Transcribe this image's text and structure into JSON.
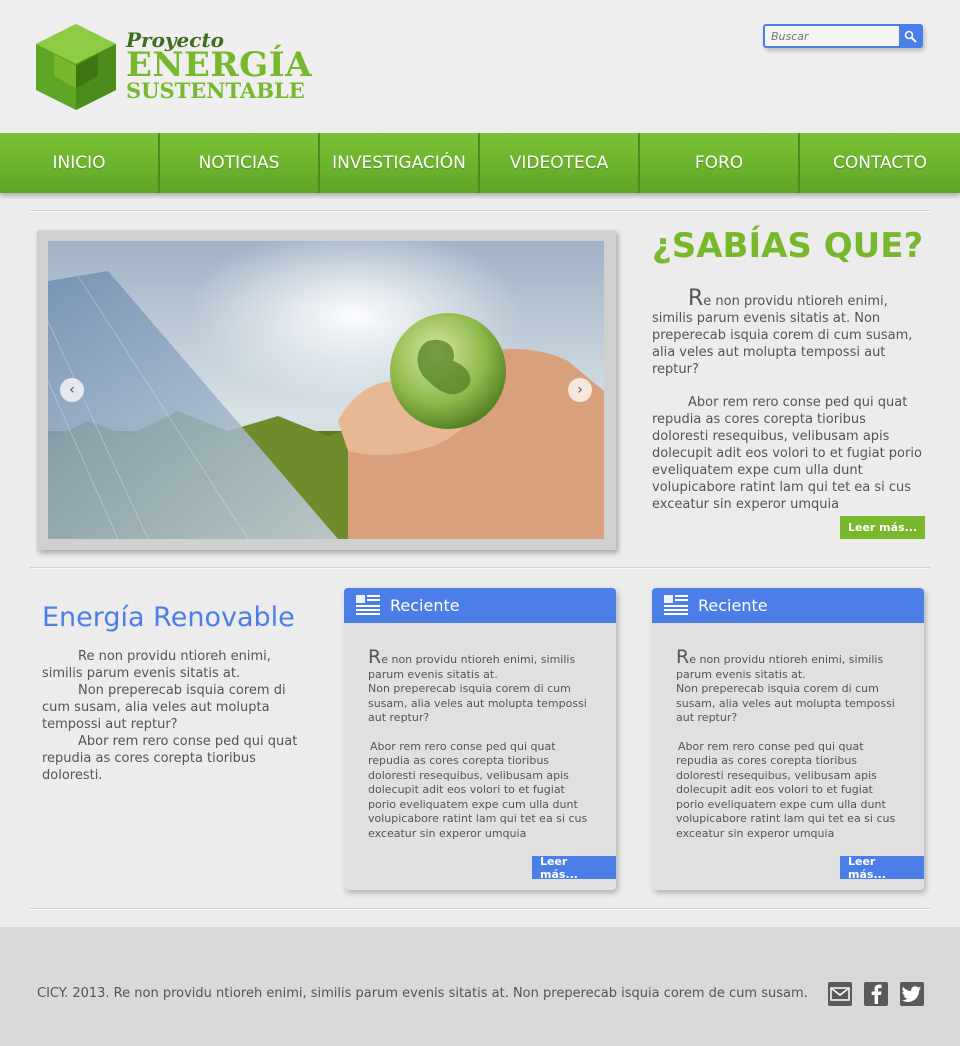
{
  "header": {
    "logo_line1": "Proyecto",
    "logo_line2": "ENERGÍA",
    "logo_line3": "SUSTENTABLE",
    "search_placeholder": "Buscar"
  },
  "nav": {
    "items": [
      {
        "label": "INICIO"
      },
      {
        "label": "NOTICIAS"
      },
      {
        "label": "INVESTIGACIÓN"
      },
      {
        "label": "VIDEOTECA"
      },
      {
        "label": "FORO"
      },
      {
        "label": "CONTACTO"
      }
    ]
  },
  "slider": {
    "image": "hands-holding-globe-solar-panel",
    "prev_label": "‹",
    "next_label": "›"
  },
  "sabias": {
    "title": "¿SABÍAS QUE?",
    "p1_cap": "R",
    "p1": "e non providu ntioreh enimi, similis parum evenis sitatis at. Non preperecab isquia corem di cum susam, alia veles aut molupta tempossi aut reptur?",
    "p2": "Abor rem rero conse ped qui quat repudia as cores corepta tioribus doloresti resequibus, velibusam apis dolecupit adit eos volori to et fugiat porio eveliquatem expe cum ulla dunt volupicabore ratint lam qui tet ea si cus exceatur sin experor umquia",
    "button": "Leer más..."
  },
  "renovable": {
    "title": "Energía Renovable",
    "p1": "Re non providu ntioreh enimi, similis parum evenis sitatis at.",
    "p2": "Non preperecab isquia corem di cum susam, alia veles aut molupta tempossi aut reptur?",
    "p3": "Abor rem rero conse ped qui quat repudia as cores corepta tioribus doloresti."
  },
  "cards": [
    {
      "title": "Reciente",
      "cap": "R",
      "l1": "e non providu ntioreh enimi, similis parum evenis sitatis at.",
      "l2": "Non preperecab isquia corem di cum susam, alia veles aut molupta tempossi aut reptur?",
      "l3": "Abor rem rero conse ped qui quat repudia as cores corepta tioribus doloresti resequibus, velibusam apis dolecupit adit eos volori to et fugiat porio eveliquatem expe cum ulla dunt volupicabore ratint lam qui tet ea si cus exceatur sin experor umquia",
      "button": "Leer más..."
    },
    {
      "title": "Reciente",
      "cap": "R",
      "l1": "e non providu ntioreh enimi, similis parum evenis sitatis at.",
      "l2": "Non preperecab isquia corem di cum susam, alia veles aut molupta tempossi aut reptur?",
      "l3": "Abor rem rero conse ped qui quat repudia as cores corepta tioribus doloresti resequibus, velibusam apis dolecupit adit eos volori to et fugiat porio eveliquatem expe cum ulla dunt volupicabore ratint lam qui tet ea si cus exceatur sin experor umquia",
      "button": "Leer más..."
    }
  ],
  "footer": {
    "text": "CICY. 2013. Re non providu ntioreh enimi, similis parum evenis sitatis at. Non preperecab isquia corem de cum susam.",
    "icons": [
      "mail-icon",
      "facebook-icon",
      "twitter-icon"
    ]
  },
  "colors": {
    "green": "#77b82c",
    "blue": "#4c7ee8",
    "dark_green": "#3f6d1d"
  }
}
